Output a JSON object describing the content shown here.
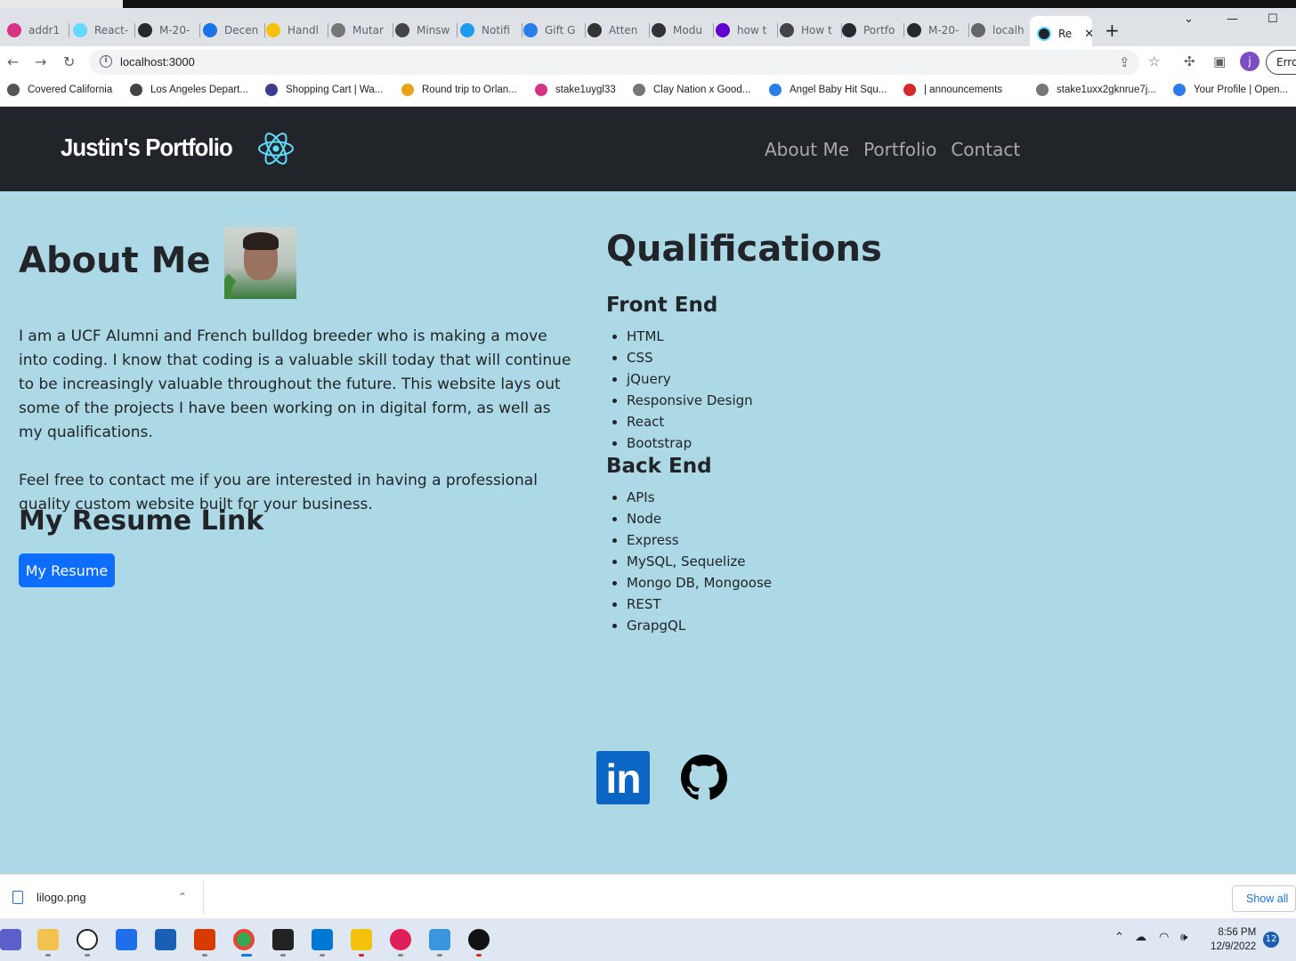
{
  "browser": {
    "tabs": [
      {
        "label": "addr1",
        "color": "#d63384"
      },
      {
        "label": "React-",
        "color": "#61dafb"
      },
      {
        "label": "M-20-",
        "color": "#24292f"
      },
      {
        "label": "Decen",
        "color": "#1a73e8"
      },
      {
        "label": "Handl",
        "color": "#f4c20d"
      },
      {
        "label": "Mutar",
        "color": "#777777"
      },
      {
        "label": "Minsw",
        "color": "#444444"
      },
      {
        "label": "Notifi",
        "color": "#1d9bf0"
      },
      {
        "label": "Gift G",
        "color": "#2b7de9"
      },
      {
        "label": "Atten",
        "color": "#333333"
      },
      {
        "label": "Modu",
        "color": "#333333"
      },
      {
        "label": "how t",
        "color": "#6001d2"
      },
      {
        "label": "How t",
        "color": "#444444"
      },
      {
        "label": "Portfo",
        "color": "#24292f"
      },
      {
        "label": "M-20-",
        "color": "#24292f"
      },
      {
        "label": "localh",
        "color": "#666666"
      }
    ],
    "active_tab": "Re",
    "url": "localhost:3000",
    "profile_initial": "j",
    "error_label": "Erro",
    "bookmarks": [
      {
        "label": "Covered California",
        "color": "#555555"
      },
      {
        "label": "Los Angeles Depart...",
        "color": "#444444"
      },
      {
        "label": "Shopping Cart | Wa...",
        "color": "#3b3b8f"
      },
      {
        "label": "Round trip to Orlan...",
        "color": "#e8a317"
      },
      {
        "label": "stake1uygl33",
        "color": "#d63384"
      },
      {
        "label": "Clay Nation x Good...",
        "color": "#777777"
      },
      {
        "label": "Angel Baby Hit Squ...",
        "color": "#2b7de9"
      },
      {
        "label": "| announcements",
        "color": "#d62828"
      },
      {
        "label": "stake1uxx2gknrue7j...",
        "color": "#777777"
      },
      {
        "label": "Your Profile | Open...",
        "color": "#2b7de9"
      }
    ]
  },
  "site": {
    "brand": "Justin's Portfolio",
    "nav": [
      "About Me",
      "Portfolio",
      "Contact"
    ],
    "about": {
      "heading": "About Me",
      "paragraph1": "I am a UCF Alumni and French bulldog breeder who is making a move into coding. I know that coding is a valuable skill today that will continue to be increasingly valuable throughout the future. This website lays out some of the projects I have been working on in digital form, as well as my qualifications.",
      "paragraph2": "Feel free to contact me if you are interested in having a professional quality custom website built for your business.",
      "resume_heading": "My Resume Link",
      "resume_button": "My Resume"
    },
    "qualifications": {
      "heading": "Qualifications",
      "front_end_heading": "Front End",
      "front_end": [
        "HTML",
        "CSS",
        "jQuery",
        "Responsive Design",
        "React",
        "Bootstrap"
      ],
      "back_end_heading": "Back End",
      "back_end": [
        "APIs",
        "Node",
        "Express",
        "MySQL, Sequelize",
        "Mongo DB, Mongoose",
        "REST",
        "GrapgQL"
      ]
    },
    "socials": {
      "linkedin_text": "in"
    }
  },
  "downloads": {
    "file": "lilogo.png",
    "show_all": "Show all"
  },
  "taskbar": {
    "time": "8:56 PM",
    "date": "12/9/2022",
    "notifications": "12"
  }
}
